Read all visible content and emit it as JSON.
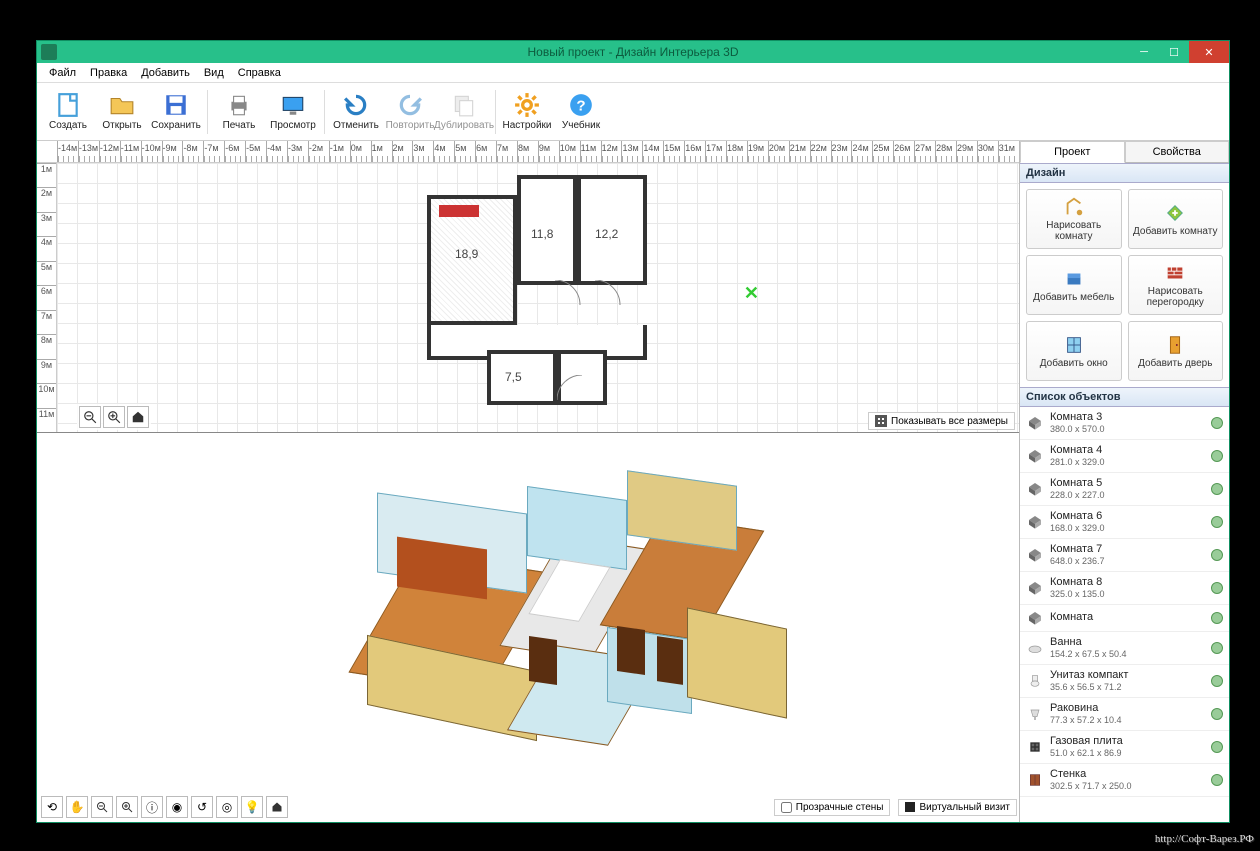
{
  "window": {
    "title": "Новый проект - Дизайн Интерьера 3D"
  },
  "menu": [
    "Файл",
    "Правка",
    "Добавить",
    "Вид",
    "Справка"
  ],
  "toolbar": [
    {
      "id": "create",
      "label": "Создать"
    },
    {
      "id": "open",
      "label": "Открыть"
    },
    {
      "id": "save",
      "label": "Сохранить"
    },
    {
      "sep": true
    },
    {
      "id": "print",
      "label": "Печать"
    },
    {
      "id": "preview",
      "label": "Просмотр"
    },
    {
      "sep": true
    },
    {
      "id": "undo",
      "label": "Отменить"
    },
    {
      "id": "redo",
      "label": "Повторить"
    },
    {
      "id": "duplicate",
      "label": "Дублировать"
    },
    {
      "sep": true
    },
    {
      "id": "settings",
      "label": "Настройки"
    },
    {
      "id": "manual",
      "label": "Учебник"
    }
  ],
  "ruler_h": [
    "-14м",
    "-13м",
    "-12м",
    "-11м",
    "-10м",
    "-9м",
    "-8м",
    "-7м",
    "-6м",
    "-5м",
    "-4м",
    "-3м",
    "-2м",
    "-1м",
    "0м",
    "1м",
    "2м",
    "3м",
    "4м",
    "5м",
    "6м",
    "7м",
    "8м",
    "9м",
    "10м",
    "11м",
    "12м",
    "13м",
    "14м",
    "15м",
    "16м",
    "17м",
    "18м",
    "19м",
    "20м",
    "21м",
    "22м",
    "23м",
    "24м",
    "25м",
    "26м",
    "27м",
    "28м",
    "29м",
    "30м",
    "31м"
  ],
  "ruler_v": [
    "1м",
    "2м",
    "3м",
    "4м",
    "5м",
    "6м",
    "7м",
    "8м",
    "9м",
    "10м",
    "11м"
  ],
  "room_labels": {
    "big": "18,9",
    "mid": "11,8",
    "right": "12,2",
    "small": "7,5"
  },
  "plan_toolbar": {
    "show_all_sizes": "Показывать все размеры"
  },
  "bottom_options": {
    "transparent_walls": "Прозрачные стены",
    "virtual_visit": "Виртуальный визит"
  },
  "tabs": {
    "project": "Проект",
    "properties": "Свойства"
  },
  "group_design": "Дизайн",
  "design_buttons": [
    {
      "id": "draw-room",
      "label": "Нарисовать комнату"
    },
    {
      "id": "add-room",
      "label": "Добавить комнату"
    },
    {
      "id": "add-furniture",
      "label": "Добавить мебель"
    },
    {
      "id": "draw-partition",
      "label": "Нарисовать перегородку"
    },
    {
      "id": "add-window",
      "label": "Добавить окно"
    },
    {
      "id": "add-door",
      "label": "Добавить дверь"
    }
  ],
  "group_objects": "Список объектов",
  "objects": [
    {
      "type": "room",
      "title": "Комната 3",
      "size": "380.0 x 570.0"
    },
    {
      "type": "room",
      "title": "Комната 4",
      "size": "281.0 x 329.0"
    },
    {
      "type": "room",
      "title": "Комната 5",
      "size": "228.0 x 227.0"
    },
    {
      "type": "room",
      "title": "Комната 6",
      "size": "168.0 x 329.0"
    },
    {
      "type": "room",
      "title": "Комната 7",
      "size": "648.0 x 236.7"
    },
    {
      "type": "room",
      "title": "Комната 8",
      "size": "325.0 x 135.0"
    },
    {
      "type": "room",
      "title": "Комната",
      "size": ""
    },
    {
      "type": "bath",
      "title": "Ванна",
      "size": "154.2 x 67.5 x 50.4"
    },
    {
      "type": "toilet",
      "title": "Унитаз компакт",
      "size": "35.6 x 56.5 x 71.2"
    },
    {
      "type": "sink",
      "title": "Раковина",
      "size": "77.3 x 57.2 x 10.4"
    },
    {
      "type": "stove",
      "title": "Газовая плита",
      "size": "51.0 x 62.1 x 86.9"
    },
    {
      "type": "wardrobe",
      "title": "Стенка",
      "size": "302.5 x 71.7 x 250.0"
    }
  ],
  "watermark": "http://Софт-Варез.РФ"
}
